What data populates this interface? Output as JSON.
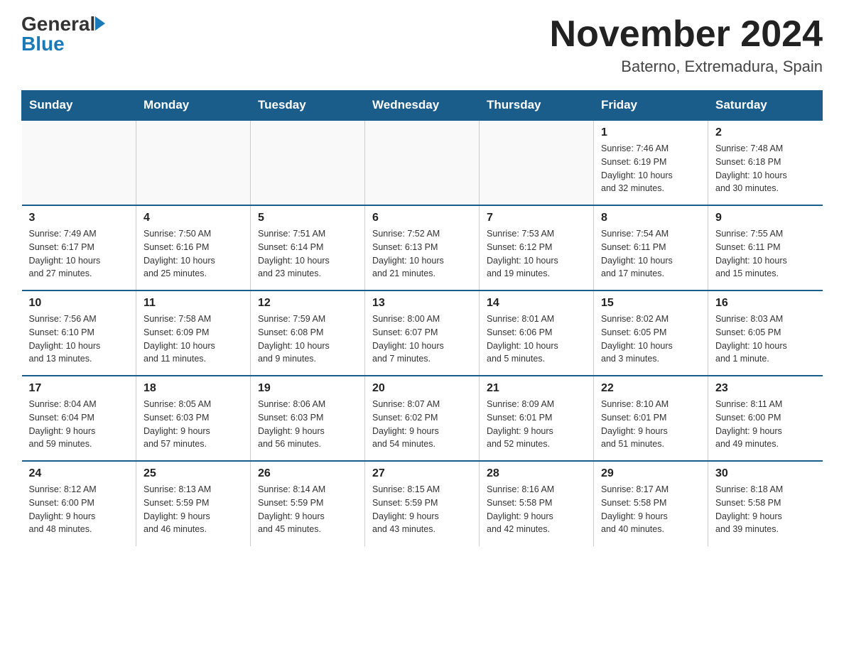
{
  "header": {
    "logo_general": "General",
    "logo_blue": "Blue",
    "month_title": "November 2024",
    "location": "Baterno, Extremadura, Spain"
  },
  "weekdays": [
    "Sunday",
    "Monday",
    "Tuesday",
    "Wednesday",
    "Thursday",
    "Friday",
    "Saturday"
  ],
  "weeks": [
    [
      {
        "day": "",
        "info": ""
      },
      {
        "day": "",
        "info": ""
      },
      {
        "day": "",
        "info": ""
      },
      {
        "day": "",
        "info": ""
      },
      {
        "day": "",
        "info": ""
      },
      {
        "day": "1",
        "info": "Sunrise: 7:46 AM\nSunset: 6:19 PM\nDaylight: 10 hours\nand 32 minutes."
      },
      {
        "day": "2",
        "info": "Sunrise: 7:48 AM\nSunset: 6:18 PM\nDaylight: 10 hours\nand 30 minutes."
      }
    ],
    [
      {
        "day": "3",
        "info": "Sunrise: 7:49 AM\nSunset: 6:17 PM\nDaylight: 10 hours\nand 27 minutes."
      },
      {
        "day": "4",
        "info": "Sunrise: 7:50 AM\nSunset: 6:16 PM\nDaylight: 10 hours\nand 25 minutes."
      },
      {
        "day": "5",
        "info": "Sunrise: 7:51 AM\nSunset: 6:14 PM\nDaylight: 10 hours\nand 23 minutes."
      },
      {
        "day": "6",
        "info": "Sunrise: 7:52 AM\nSunset: 6:13 PM\nDaylight: 10 hours\nand 21 minutes."
      },
      {
        "day": "7",
        "info": "Sunrise: 7:53 AM\nSunset: 6:12 PM\nDaylight: 10 hours\nand 19 minutes."
      },
      {
        "day": "8",
        "info": "Sunrise: 7:54 AM\nSunset: 6:11 PM\nDaylight: 10 hours\nand 17 minutes."
      },
      {
        "day": "9",
        "info": "Sunrise: 7:55 AM\nSunset: 6:11 PM\nDaylight: 10 hours\nand 15 minutes."
      }
    ],
    [
      {
        "day": "10",
        "info": "Sunrise: 7:56 AM\nSunset: 6:10 PM\nDaylight: 10 hours\nand 13 minutes."
      },
      {
        "day": "11",
        "info": "Sunrise: 7:58 AM\nSunset: 6:09 PM\nDaylight: 10 hours\nand 11 minutes."
      },
      {
        "day": "12",
        "info": "Sunrise: 7:59 AM\nSunset: 6:08 PM\nDaylight: 10 hours\nand 9 minutes."
      },
      {
        "day": "13",
        "info": "Sunrise: 8:00 AM\nSunset: 6:07 PM\nDaylight: 10 hours\nand 7 minutes."
      },
      {
        "day": "14",
        "info": "Sunrise: 8:01 AM\nSunset: 6:06 PM\nDaylight: 10 hours\nand 5 minutes."
      },
      {
        "day": "15",
        "info": "Sunrise: 8:02 AM\nSunset: 6:05 PM\nDaylight: 10 hours\nand 3 minutes."
      },
      {
        "day": "16",
        "info": "Sunrise: 8:03 AM\nSunset: 6:05 PM\nDaylight: 10 hours\nand 1 minute."
      }
    ],
    [
      {
        "day": "17",
        "info": "Sunrise: 8:04 AM\nSunset: 6:04 PM\nDaylight: 9 hours\nand 59 minutes."
      },
      {
        "day": "18",
        "info": "Sunrise: 8:05 AM\nSunset: 6:03 PM\nDaylight: 9 hours\nand 57 minutes."
      },
      {
        "day": "19",
        "info": "Sunrise: 8:06 AM\nSunset: 6:03 PM\nDaylight: 9 hours\nand 56 minutes."
      },
      {
        "day": "20",
        "info": "Sunrise: 8:07 AM\nSunset: 6:02 PM\nDaylight: 9 hours\nand 54 minutes."
      },
      {
        "day": "21",
        "info": "Sunrise: 8:09 AM\nSunset: 6:01 PM\nDaylight: 9 hours\nand 52 minutes."
      },
      {
        "day": "22",
        "info": "Sunrise: 8:10 AM\nSunset: 6:01 PM\nDaylight: 9 hours\nand 51 minutes."
      },
      {
        "day": "23",
        "info": "Sunrise: 8:11 AM\nSunset: 6:00 PM\nDaylight: 9 hours\nand 49 minutes."
      }
    ],
    [
      {
        "day": "24",
        "info": "Sunrise: 8:12 AM\nSunset: 6:00 PM\nDaylight: 9 hours\nand 48 minutes."
      },
      {
        "day": "25",
        "info": "Sunrise: 8:13 AM\nSunset: 5:59 PM\nDaylight: 9 hours\nand 46 minutes."
      },
      {
        "day": "26",
        "info": "Sunrise: 8:14 AM\nSunset: 5:59 PM\nDaylight: 9 hours\nand 45 minutes."
      },
      {
        "day": "27",
        "info": "Sunrise: 8:15 AM\nSunset: 5:59 PM\nDaylight: 9 hours\nand 43 minutes."
      },
      {
        "day": "28",
        "info": "Sunrise: 8:16 AM\nSunset: 5:58 PM\nDaylight: 9 hours\nand 42 minutes."
      },
      {
        "day": "29",
        "info": "Sunrise: 8:17 AM\nSunset: 5:58 PM\nDaylight: 9 hours\nand 40 minutes."
      },
      {
        "day": "30",
        "info": "Sunrise: 8:18 AM\nSunset: 5:58 PM\nDaylight: 9 hours\nand 39 minutes."
      }
    ]
  ]
}
